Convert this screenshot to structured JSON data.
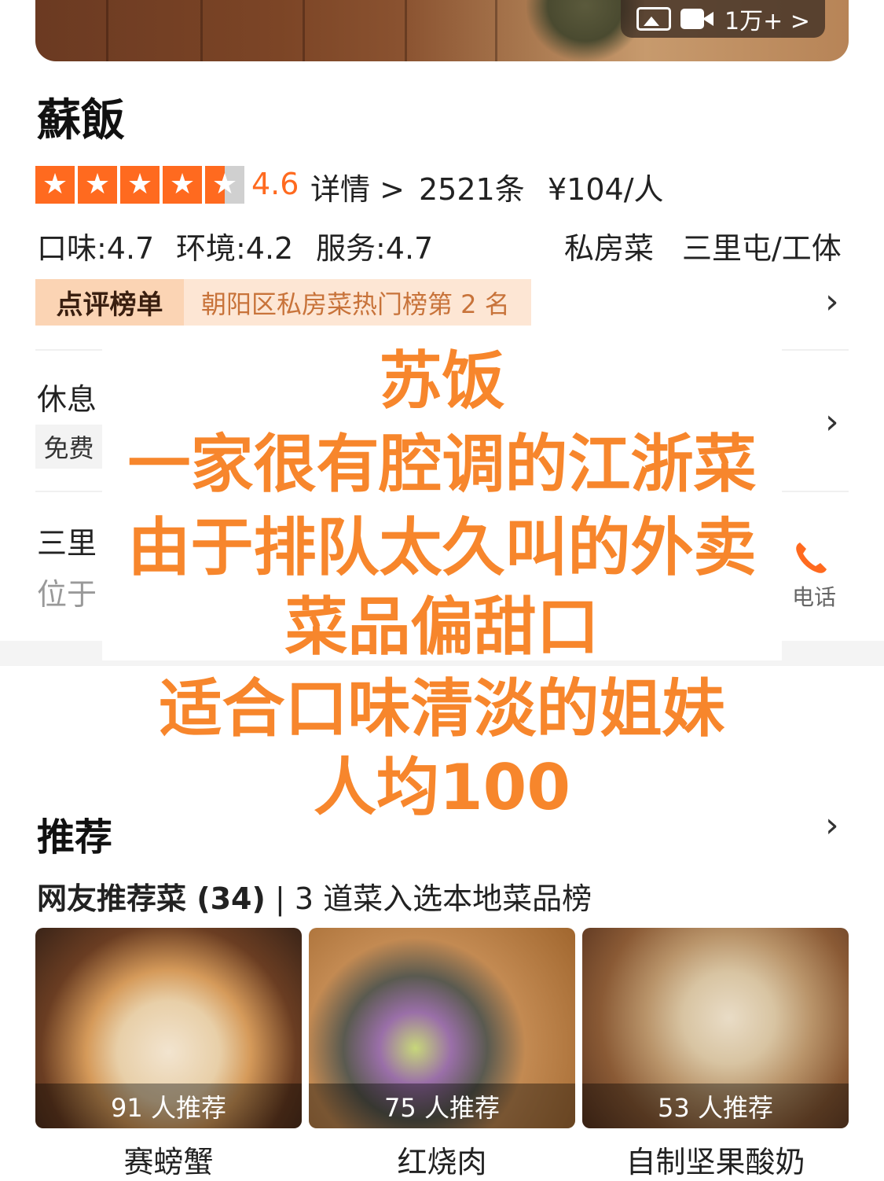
{
  "hero": {
    "media_count": "1万+ >"
  },
  "shop": {
    "name": "蘇飯",
    "rating": "4.6",
    "detail_label": "详情 >",
    "review_count": "2521条",
    "avg_price": "¥104/人",
    "scores": {
      "taste": "口味:4.7",
      "environment": "环境:4.2",
      "service": "服务:4.7"
    },
    "category": "私房菜",
    "district": "三里屯/工体",
    "stars": 4.6
  },
  "ranking": {
    "tag": "点评榜单",
    "text": "朝阳区私房菜热门榜第 2 名"
  },
  "info": {
    "hours_label": "休息",
    "free_tag": "免费",
    "address_label": "三里",
    "address_sub": "位于",
    "phone_label": "电话"
  },
  "overlay": {
    "lines": [
      "苏饭",
      "一家很有腔调的江浙菜",
      "由于排队太久叫的外卖",
      "菜品偏甜口",
      "适合口味清淡的姐妹",
      "人均100"
    ]
  },
  "recommend": {
    "title": "推荐",
    "subtitle_bold": "网友推荐菜 (34)",
    "subtitle_rest": "| 3 道菜入选本地菜品榜",
    "dishes": [
      {
        "name": "赛螃蟹",
        "count": "91 人推荐"
      },
      {
        "name": "红烧肉",
        "count": "75 人推荐"
      },
      {
        "name": "自制坚果酸奶",
        "count": "53 人推荐"
      }
    ]
  },
  "colors": {
    "accent": "#ff6a1f",
    "overlay_text": "#f7862c",
    "rank_bg": "#fde6d4"
  },
  "icons": [
    "photo-icon",
    "video-icon",
    "star-icon",
    "chevron-right-icon",
    "phone-icon"
  ]
}
